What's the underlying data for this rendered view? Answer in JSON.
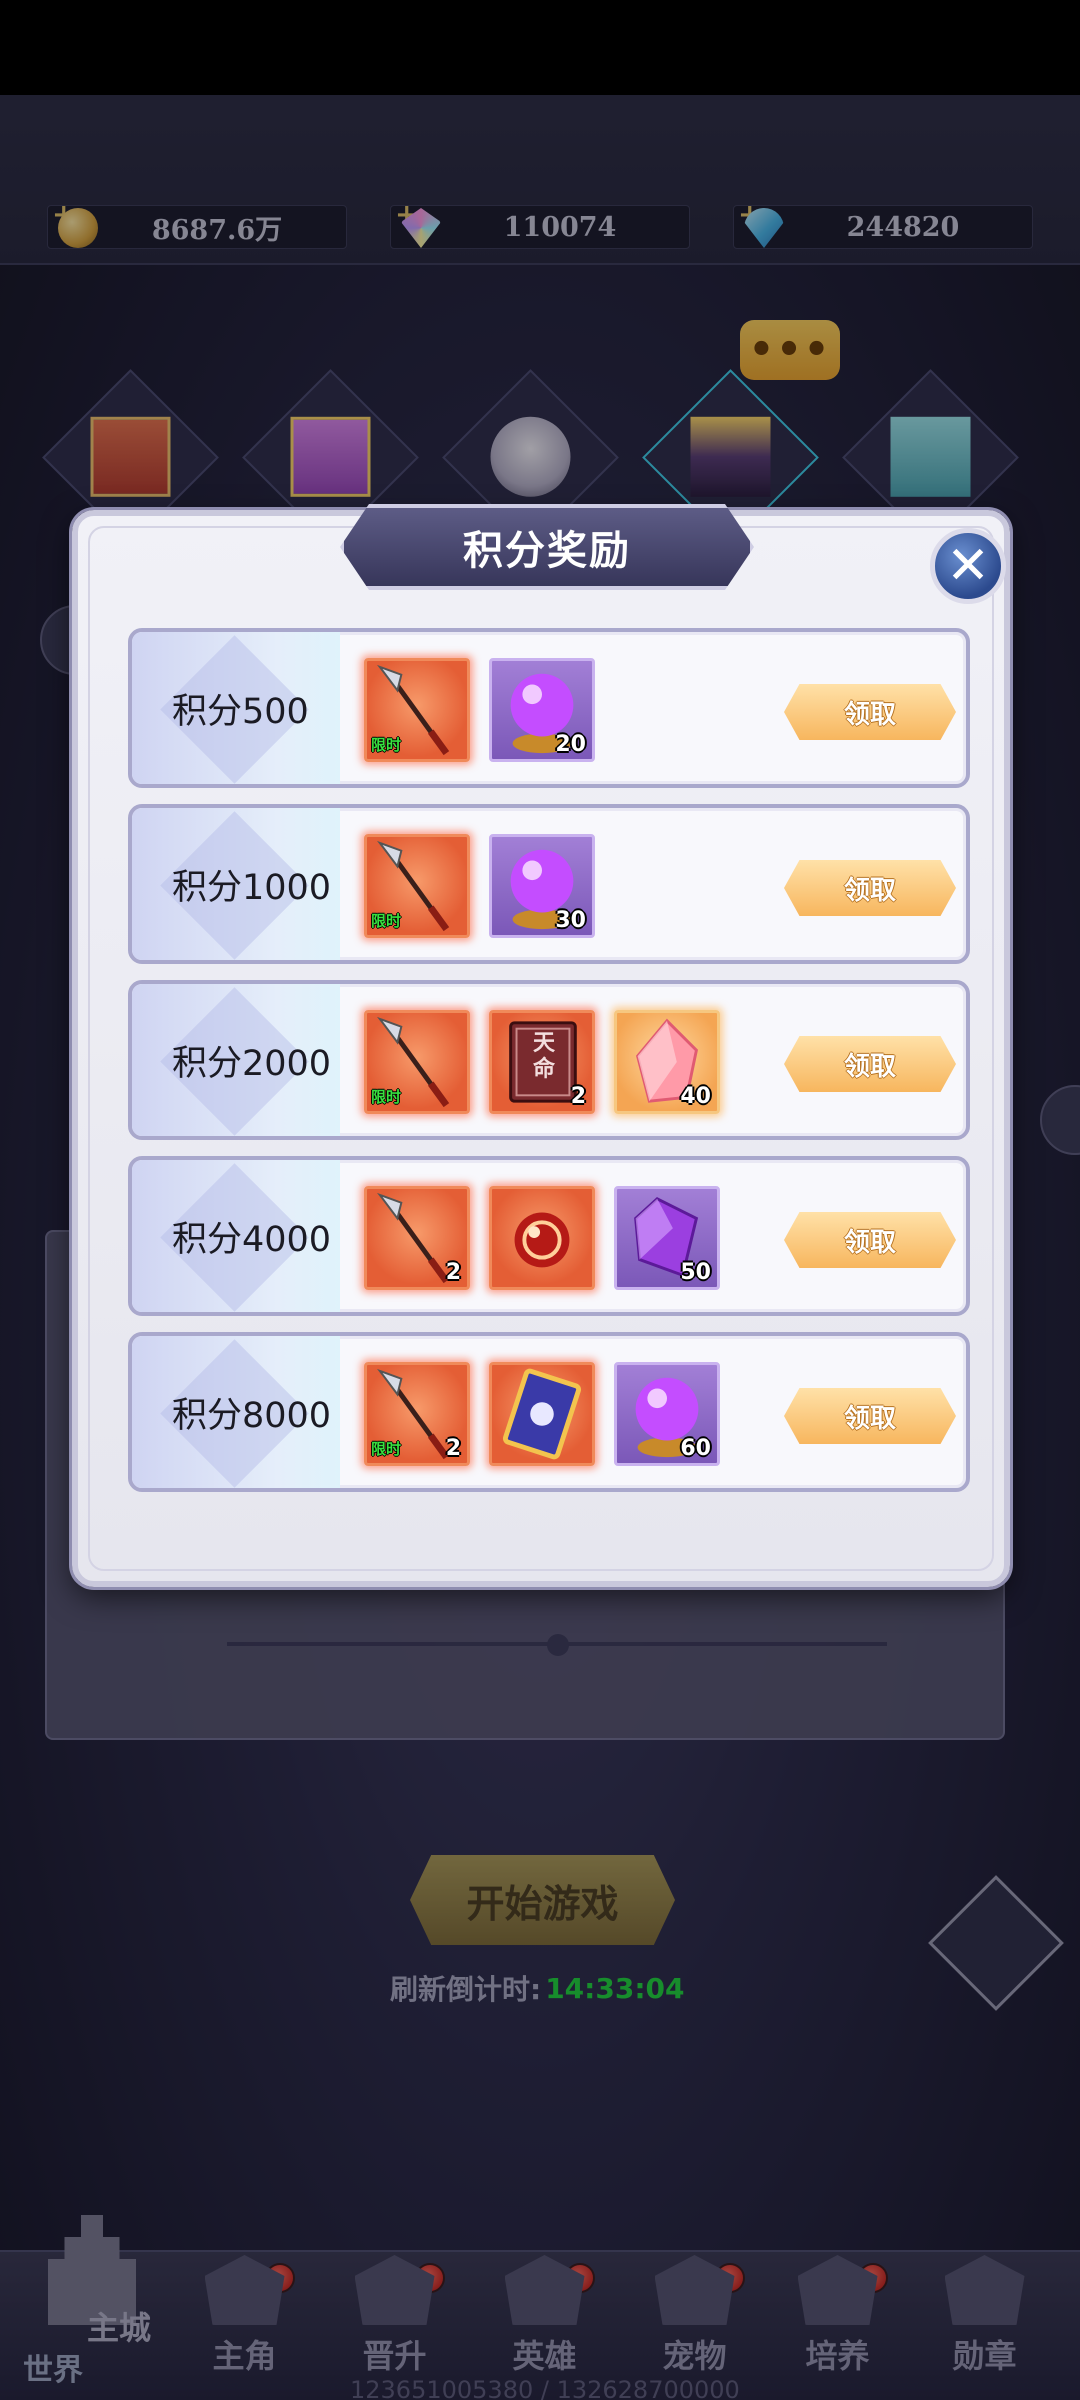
{
  "currencies": [
    {
      "icon": "gold-coin-icon",
      "value": "8687.6万"
    },
    {
      "icon": "gem-icon",
      "value": "110074"
    },
    {
      "icon": "diamond-icon",
      "value": "244820"
    }
  ],
  "event_bubble": "•••",
  "modal": {
    "title": "积分奖励",
    "close_label": "✕",
    "claim_label": "领取",
    "rows": [
      {
        "label": "积分500",
        "items": [
          {
            "icon": "spear-icon",
            "style": "orange",
            "tag": "限时",
            "count": ""
          },
          {
            "icon": "crystal-ball-icon",
            "style": "purple",
            "tag": "",
            "count": "20"
          }
        ]
      },
      {
        "label": "积分1000",
        "items": [
          {
            "icon": "spear-icon",
            "style": "orange",
            "tag": "限时",
            "count": ""
          },
          {
            "icon": "crystal-ball-icon",
            "style": "purple",
            "tag": "",
            "count": "30"
          }
        ]
      },
      {
        "label": "积分2000",
        "items": [
          {
            "icon": "spear-icon",
            "style": "orange",
            "tag": "限时",
            "count": ""
          },
          {
            "icon": "destiny-book-icon",
            "style": "orange",
            "tag": "",
            "count": "2",
            "book_text": "天命"
          },
          {
            "icon": "pink-crystal-icon",
            "style": "gold",
            "tag": "",
            "count": "40"
          }
        ]
      },
      {
        "label": "积分4000",
        "items": [
          {
            "icon": "spear-icon",
            "style": "orange",
            "tag": "",
            "count": "2"
          },
          {
            "icon": "red-orb-icon",
            "style": "orange",
            "tag": "",
            "count": ""
          },
          {
            "icon": "purple-gem-icon",
            "style": "purple",
            "tag": "",
            "count": "50"
          }
        ]
      },
      {
        "label": "积分8000",
        "items": [
          {
            "icon": "spear-icon",
            "style": "orange",
            "tag": "限时",
            "count": "2"
          },
          {
            "icon": "card-icon",
            "style": "orange",
            "tag": "",
            "count": ""
          },
          {
            "icon": "crystal-ball-icon",
            "style": "purple",
            "tag": "",
            "count": "60"
          }
        ]
      }
    ]
  },
  "start_button": "开始游戏",
  "refresh": {
    "label": "刷新倒计时:",
    "time": "14:33:04"
  },
  "bottom_nav": {
    "world_label": "世界",
    "main_city_label": "主城",
    "items": [
      {
        "label": "主角",
        "icon": "hero-helmet-icon"
      },
      {
        "label": "晋升",
        "icon": "wings-icon"
      },
      {
        "label": "英雄",
        "icon": "knight-helmet-icon"
      },
      {
        "label": "宠物",
        "icon": "pet-icon"
      },
      {
        "label": "培养",
        "icon": "compass-icon"
      },
      {
        "label": "勋章",
        "icon": "medal-icon"
      }
    ]
  },
  "footer": "123651005380 / 132628700000"
}
